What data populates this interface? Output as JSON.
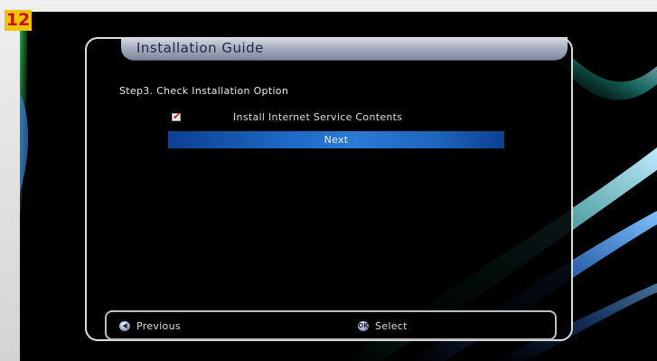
{
  "badge": {
    "number": "12"
  },
  "dialog": {
    "title": "Installation Guide",
    "step_text": "Step3. Check Installation Option",
    "option": {
      "label": "Install Internet Service Contents",
      "checked": true
    },
    "next_label": "Next"
  },
  "footer": {
    "previous": {
      "icon": "left-arrow-remote-icon",
      "label": "Previous"
    },
    "select": {
      "icon": "ok-remote-icon",
      "label": "Select"
    }
  },
  "colors": {
    "badge_bg": "#f2c400",
    "badge_text": "#c0141c",
    "highlight": "#1d68c4",
    "checkmark": "#d41e1e"
  }
}
